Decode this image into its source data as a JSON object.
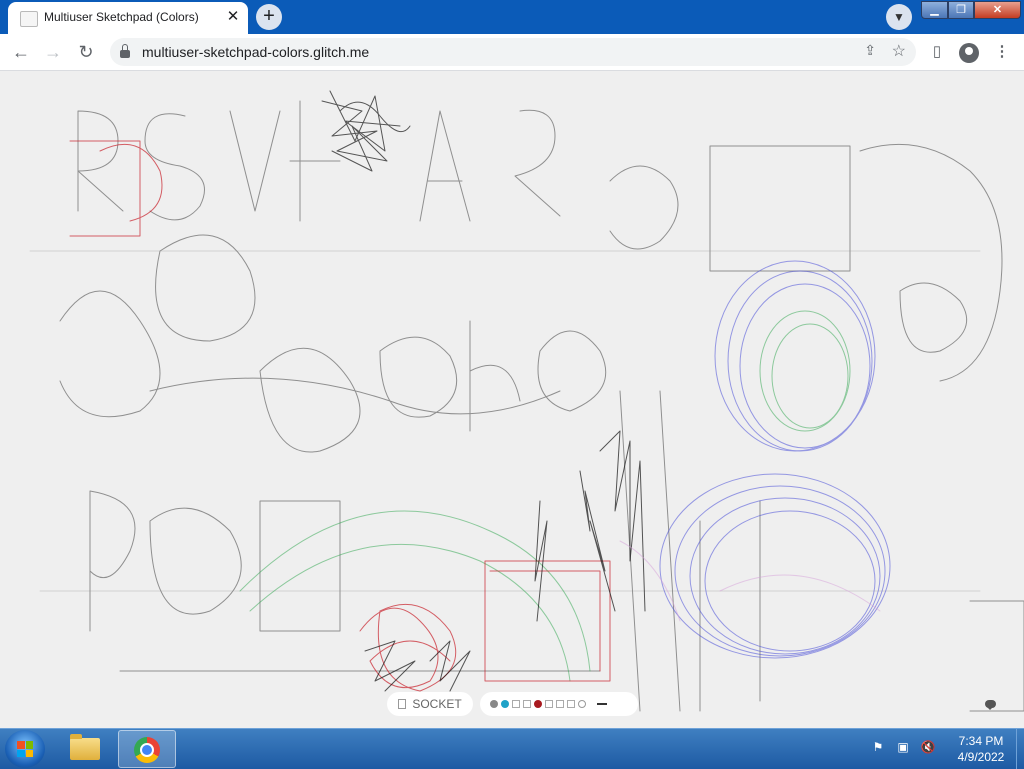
{
  "browser": {
    "tab_title": "Multiuser Sketchpad (Colors)",
    "url": "multiuser-sketchpad-colors.glitch.me"
  },
  "sketchpad": {
    "socket_label": "SOCKET",
    "palette": [
      {
        "type": "dot",
        "color": "#888888"
      },
      {
        "type": "dot",
        "color": "#1fa2c7"
      },
      {
        "type": "square",
        "color": "#ffffff"
      },
      {
        "type": "square",
        "color": "#ffffff"
      },
      {
        "type": "dot",
        "color": "#a8191f"
      },
      {
        "type": "square",
        "color": "#ffffff"
      },
      {
        "type": "square",
        "color": "#ffffff"
      },
      {
        "type": "square",
        "color": "#ffffff"
      },
      {
        "type": "ring",
        "color": "#ffffff"
      }
    ]
  },
  "taskbar": {
    "time": "7:34 PM",
    "date": "4/9/2022"
  }
}
